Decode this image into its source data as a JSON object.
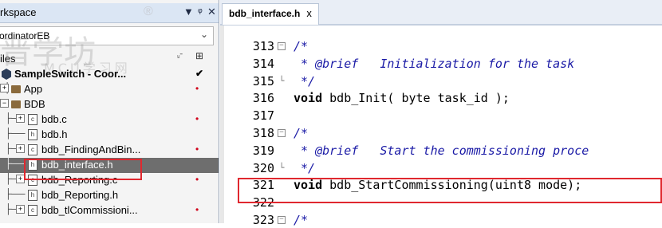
{
  "workspace": {
    "title": "rkspace",
    "registered": "®",
    "buttons": {
      "dropdown": "▼",
      "pin": "ᵠ",
      "close": "✕"
    },
    "config_value": "ordinatorEB",
    "tree_header": {
      "files_label": "iles",
      "col1_icon": "options-icon",
      "col2_icon": "output-icon"
    },
    "watermark": {
      "line1": "晋学坊",
      "line2": "MCU学习网"
    },
    "tree": [
      {
        "label": "SampleSwitch - Coor...",
        "kind": "project",
        "mark": "✔"
      },
      {
        "label": "App",
        "kind": "folder",
        "mark": "•"
      },
      {
        "label": "BDB",
        "kind": "folder",
        "mark": ""
      },
      {
        "label": "bdb.c",
        "kind": "c-file",
        "mark": "•"
      },
      {
        "label": "bdb.h",
        "kind": "h-file",
        "mark": ""
      },
      {
        "label": "bdb_FindingAndBin...",
        "kind": "c-file",
        "mark": "•"
      },
      {
        "label": "bdb_interface.h",
        "kind": "h-file",
        "mark": "",
        "selected": true
      },
      {
        "label": "bdb_Reporting.c",
        "kind": "c-file",
        "mark": "•"
      },
      {
        "label": "bdb_Reporting.h",
        "kind": "h-file",
        "mark": ""
      },
      {
        "label": "bdb_tlCommissioni...",
        "kind": "c-file",
        "mark": "•"
      }
    ]
  },
  "editor": {
    "tab": {
      "label": "bdb_interface.h",
      "close": "x"
    },
    "lines": [
      {
        "num": "313",
        "fold": "minus",
        "parts": [
          {
            "t": "/*",
            "c": "cm"
          }
        ]
      },
      {
        "num": "314",
        "fold": "",
        "parts": [
          {
            "t": " * @brief   Initialization for the task",
            "c": "cm"
          }
        ]
      },
      {
        "num": "315",
        "fold": "end",
        "parts": [
          {
            "t": " */",
            "c": "cm"
          }
        ]
      },
      {
        "num": "316",
        "fold": "",
        "parts": [
          {
            "t": "void",
            "c": "kw"
          },
          {
            "t": " bdb_Init( byte task_id );",
            "c": ""
          }
        ]
      },
      {
        "num": "317",
        "fold": "",
        "parts": [
          {
            "t": "",
            "c": ""
          }
        ]
      },
      {
        "num": "318",
        "fold": "minus",
        "parts": [
          {
            "t": "/*",
            "c": "cm"
          }
        ]
      },
      {
        "num": "319",
        "fold": "",
        "parts": [
          {
            "t": " * @brief   Start the commissioning proce",
            "c": "cm"
          }
        ]
      },
      {
        "num": "320",
        "fold": "end",
        "parts": [
          {
            "t": " */",
            "c": "cm"
          }
        ]
      },
      {
        "num": "321",
        "fold": "",
        "parts": [
          {
            "t": "void",
            "c": "kw"
          },
          {
            "t": " bdb_StartCommissioning(uint8 mode);",
            "c": ""
          }
        ]
      },
      {
        "num": "322",
        "fold": "",
        "parts": [
          {
            "t": "",
            "c": ""
          }
        ]
      },
      {
        "num": "323",
        "fold": "minus",
        "parts": [
          {
            "t": "/*",
            "c": "cm"
          }
        ]
      }
    ]
  },
  "colors": {
    "highlight": "#e0282f",
    "comment": "#1a1aa6",
    "selection": "#6e6e6e",
    "header": "#dbe6f4"
  }
}
